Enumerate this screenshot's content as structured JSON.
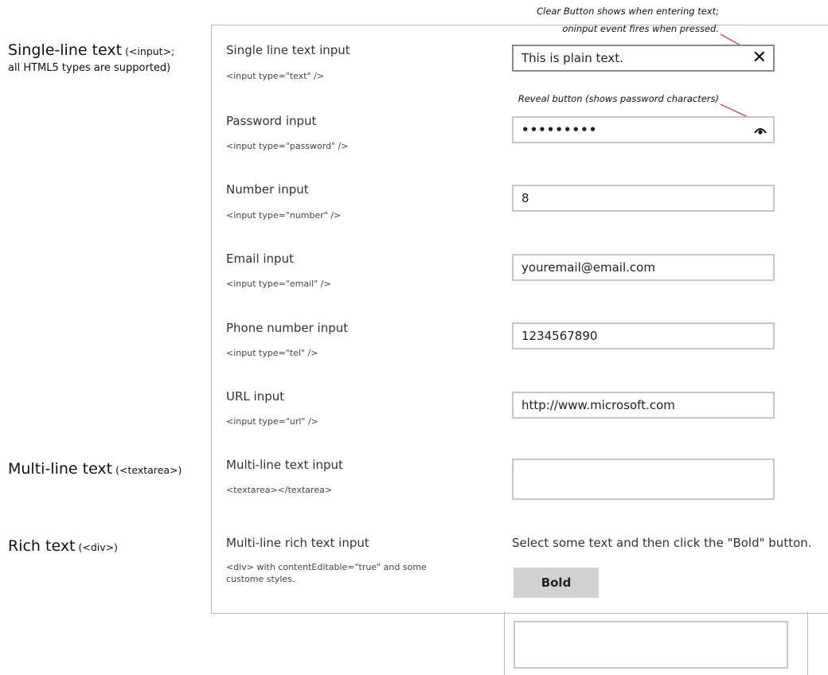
{
  "left_labels": {
    "single": {
      "main": "Single-line text",
      "paren": " (<input>;",
      "sub": "all HTML5 types are supported)"
    },
    "multi": {
      "main": "Multi-line text",
      "paren": " (<textarea>)"
    },
    "rich": {
      "main": "Rich text",
      "paren": " (<div>)"
    }
  },
  "notes": {
    "clear_line1": "Clear Button shows when entering text;",
    "clear_line2": "oninput event fires when pressed.",
    "reveal": "Reveal button (shows password characters)"
  },
  "rows": {
    "text": {
      "title": "Single line text input",
      "code": "<input type=\"text\" />",
      "value": "This is plain text.",
      "clear_glyph": "✕"
    },
    "password": {
      "title": "Password input",
      "code": "<input type=\"password\" />",
      "value": "•••••••••",
      "reveal_icon": "eye-icon"
    },
    "number": {
      "title": "Number input",
      "code": "<input type=\"number\" />",
      "value": "8"
    },
    "email": {
      "title": "Email input",
      "code": "<input type=\"email\" />",
      "value": "youremail@email.com"
    },
    "tel": {
      "title": "Phone number input",
      "code": "<input type=\"tel\" />",
      "value": "1234567890"
    },
    "url": {
      "title": "URL input",
      "code": "<input type=\"url\" />",
      "value": "http://www.microsoft.com"
    },
    "textarea": {
      "title": "Multi-line text input",
      "code": "<textarea></textarea>",
      "value": ""
    },
    "rich": {
      "title": "Multi-line rich text input",
      "code_line1": "<div> with contentEditable=\"true\" and some",
      "code_line2": "custome styles.",
      "instruction": "Select some text and then click the \"Bold\" button.",
      "bold_label": "Bold"
    }
  },
  "colors": {
    "field_border": "#c6c6c6",
    "focused_border": "#8a8a8a",
    "button_bg": "#d1d1d1",
    "annotation_line": "#c0504d"
  }
}
